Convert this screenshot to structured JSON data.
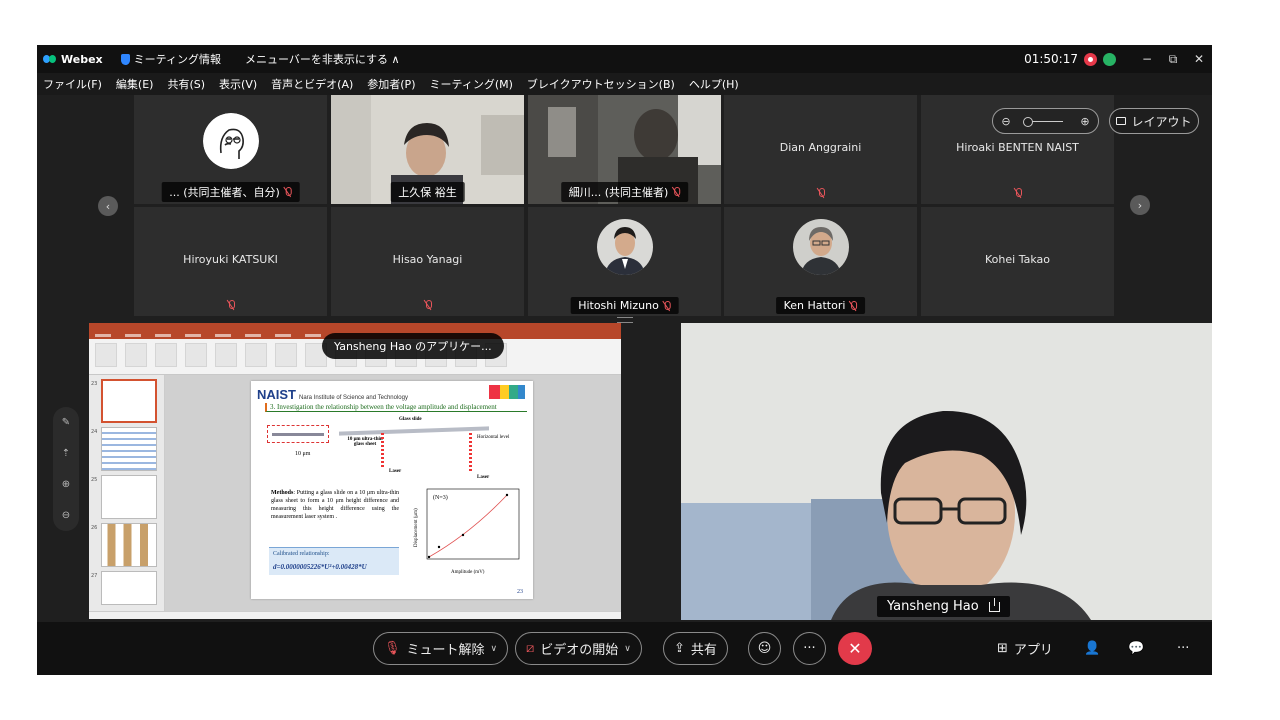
{
  "titlebar": {
    "app_name": "Webex",
    "meeting_info": "ミーティング情報",
    "hide_menu": "メニューバーを非表示にする ∧",
    "timer": "01:50:17",
    "minimize": "−",
    "restore": "⧉",
    "close": "✕"
  },
  "menu": [
    "ファイル(F)",
    "編集(E)",
    "共有(S)",
    "表示(V)",
    "音声とビデオ(A)",
    "参加者(P)",
    "ミーティング(M)",
    "ブレイクアウトセッション(B)",
    "ヘルプ(H)"
  ],
  "grid": {
    "tiles": [
      {
        "label": "... (共同主催者、自分)"
      },
      {
        "label": "上久保 裕生"
      },
      {
        "label": "細川... (共同主催者)"
      },
      {
        "label": "Dian Anggraini"
      },
      {
        "label": "Hiroaki BENTEN NAIST"
      },
      {
        "label": "Hiroyuki KATSUKI"
      },
      {
        "label": "Hisao Yanagi"
      },
      {
        "label": "Hitoshi Mizuno"
      },
      {
        "label": "Ken Hattori"
      },
      {
        "label": "Kohei Takao"
      }
    ],
    "prev": "‹",
    "next": "›",
    "zoom_out": "⊖",
    "zoom_in": "⊕",
    "layout_label": "レイアウト"
  },
  "share": {
    "tag": "Yansheng Hao のアプリケー...",
    "slide": {
      "logo_text": "NAIST",
      "institute": "Nara Institute of Science and Technology",
      "title": "3. Investigation the relationship between the voltage amplitude and displacement",
      "ten_um": "10 μm",
      "glass_sheet": "10 μm ultra-thin glass sheet",
      "glass_slide": "Glass slide",
      "horizontal": "Horizontal level",
      "laser": "Laser",
      "methods_label": "Methods",
      "methods": ": Putting a glass slide on a 10 μm ultra-thin glass sheet to form a 10 μm height difference and measuring this height difference using the measurement laser system .",
      "calib_title": "Calibrated relationship:",
      "calib_eq": "d=0.0000005226*U²+0.00428*U",
      "plot_n": "(N=3)",
      "plot_xlabel": "Amplitude (mV)",
      "plot_ylabel": "Displacement (μm)",
      "page": "23"
    },
    "thumb_nums": [
      "23",
      "24",
      "25",
      "26",
      "27"
    ]
  },
  "speaker": {
    "name": "Yansheng Hao"
  },
  "controls": {
    "unmute": "ミュート解除",
    "start_video": "ビデオの開始",
    "share": "共有",
    "reactions": "☺",
    "more": "···",
    "end": "✕",
    "apps": "アプリ",
    "more_right": "···"
  },
  "colors": {
    "accent_active": "#3fb8ea",
    "end_call": "#e23a4a",
    "record": "#e6394a"
  }
}
